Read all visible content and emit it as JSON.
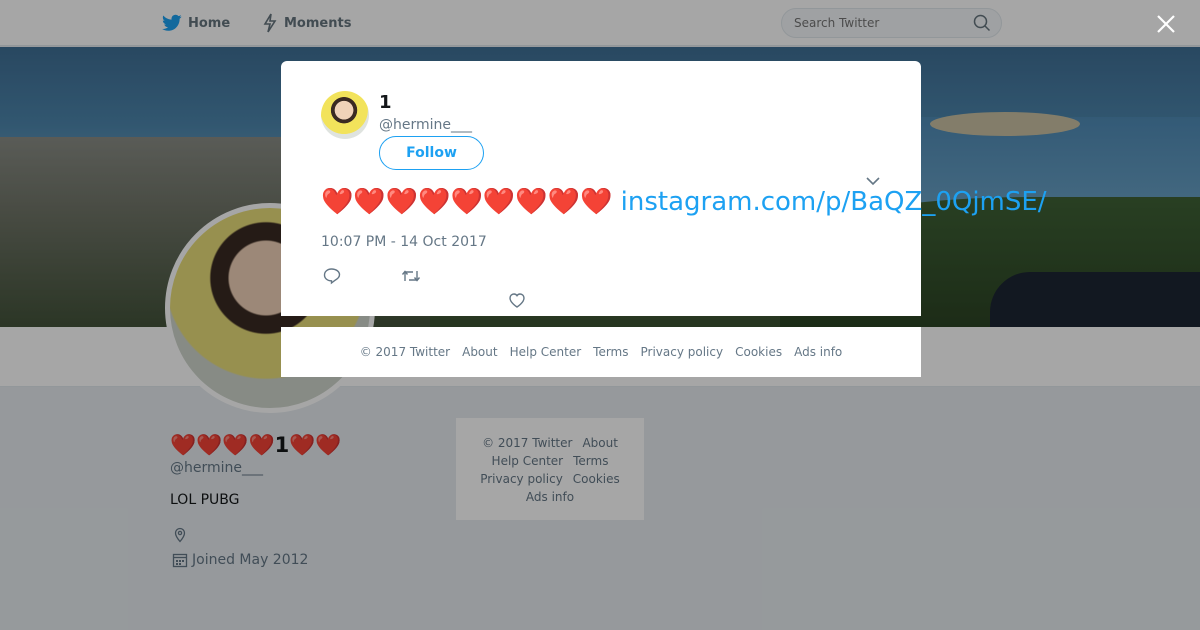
{
  "topbar": {
    "home_label": "Home",
    "moments_label": "Moments",
    "search_placeholder": "Search Twitter"
  },
  "profile": {
    "display_name": "❤️❤️❤️❤️1❤️❤️",
    "handle": "@hermine___",
    "bio": "LOL PUBG",
    "joined": "Joined May 2012"
  },
  "side_footer": {
    "links": [
      "© 2017 Twitter",
      "About",
      "Help Center",
      "Terms",
      "Privacy policy",
      "Cookies",
      "Ads info"
    ]
  },
  "tweet": {
    "author_name": "1",
    "author_handle": "@hermine___",
    "follow_label": "Follow",
    "text": "❤️❤️❤️❤️❤️❤️❤️❤️❤️",
    "link_text": "instagram.com/p/BaQZ_0QjmSE/",
    "timestamp": "10:07 PM - 14 Oct 2017"
  },
  "modal_footer": {
    "links": [
      "© 2017 Twitter",
      "About",
      "Help Center",
      "Terms",
      "Privacy policy",
      "Cookies",
      "Ads info"
    ]
  },
  "colors": {
    "accent": "#1da1f2",
    "secondary_text": "#657786"
  }
}
